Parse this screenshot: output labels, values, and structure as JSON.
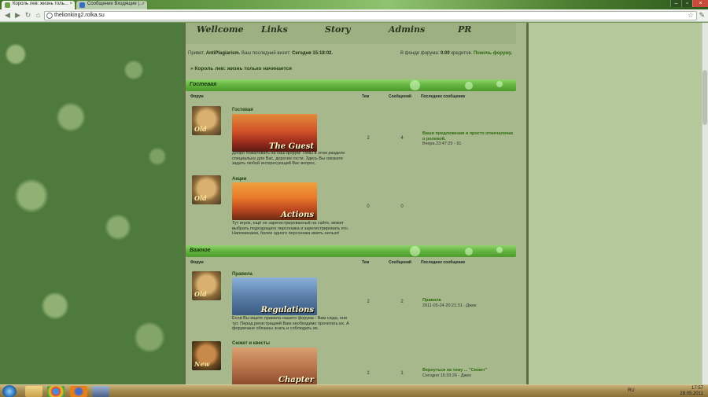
{
  "browser": {
    "tabs": [
      {
        "label": "Король лев: жизнь толь...",
        "active": true
      },
      {
        "label": "Сообщение Входящие |...",
        "active": false
      }
    ],
    "url": "thelionking2.rolka.su"
  },
  "site": {
    "menu": [
      "Wellcome",
      "Links",
      "Story",
      "Admins",
      "PR"
    ],
    "greeting": "Привет,",
    "username": "AntiPlagiarism.",
    "last_visit_label": "Ваш последний визит:",
    "last_visit_value": "Сегодня 15:18:02.",
    "fund_label": "В фонде форума:",
    "fund_value": "0.00",
    "fund_unit": "кредитов.",
    "fund_link": "Помочь форуму.",
    "breadcrumb": "» Король лев: жизнь только начинается"
  },
  "columns": {
    "forum": "Форум",
    "topics": "Тем",
    "posts": "Сообщений",
    "last": "Последнее сообщение"
  },
  "sections": [
    {
      "title": "Гостевая",
      "forums": [
        {
          "icon_label": "Old",
          "title": "Гостевая",
          "banner_text": "The Guest",
          "description": "Добро пожаловать на наш форум! Темы в этом разделе специально для Вас, дорогие гости. Здесь Вы сможете задать любой интересующий Вас вопрос.",
          "topics": "2",
          "posts": "4",
          "last_title": "Ваши предложения и просто отмечалочка о ролевой.",
          "last_meta": "Вчера 23:47:29 - 91"
        },
        {
          "icon_label": "Old",
          "title": "Акции",
          "banner_text": "Actions",
          "description": "Тут игрок, ещё не зарегистрированный на сайте, может выбрать подходящего персонажа и зарегистрировать его. Напоминаем, более одного персонажа иметь нельзя!",
          "topics": "0",
          "posts": "0",
          "last_title": "",
          "last_meta": ""
        }
      ]
    },
    {
      "title": "Важное",
      "forums": [
        {
          "icon_label": "Old",
          "title": "Правила",
          "banner_text": "Regulations",
          "description": "Если Вы ищете правила нашего форума - Вам сюда, они тут. Перед регистрацией Вам необходимо прочитать их. А форумчане обязаны знать и соблюдать их.",
          "topics": "2",
          "posts": "2",
          "last_title": "Правила",
          "last_meta": "2011-05-24 20:21:31 - Джек"
        },
        {
          "icon_label": "New",
          "title": "Сюжет и квесты",
          "banner_text": "Chapter",
          "description": "",
          "topics": "1",
          "posts": "1",
          "last_title": "Вернуться на тему ... \"Сюжет\"",
          "last_meta": "Сегодня 15:33:26 - Джек"
        }
      ]
    }
  ],
  "taskbar": {
    "lang": "RU",
    "time": "17:57",
    "date": "28.05.2011"
  },
  "colors": {
    "section_header": "#5fb13c",
    "forum_bg": "#a7b98c",
    "link": "#2f6a10"
  }
}
